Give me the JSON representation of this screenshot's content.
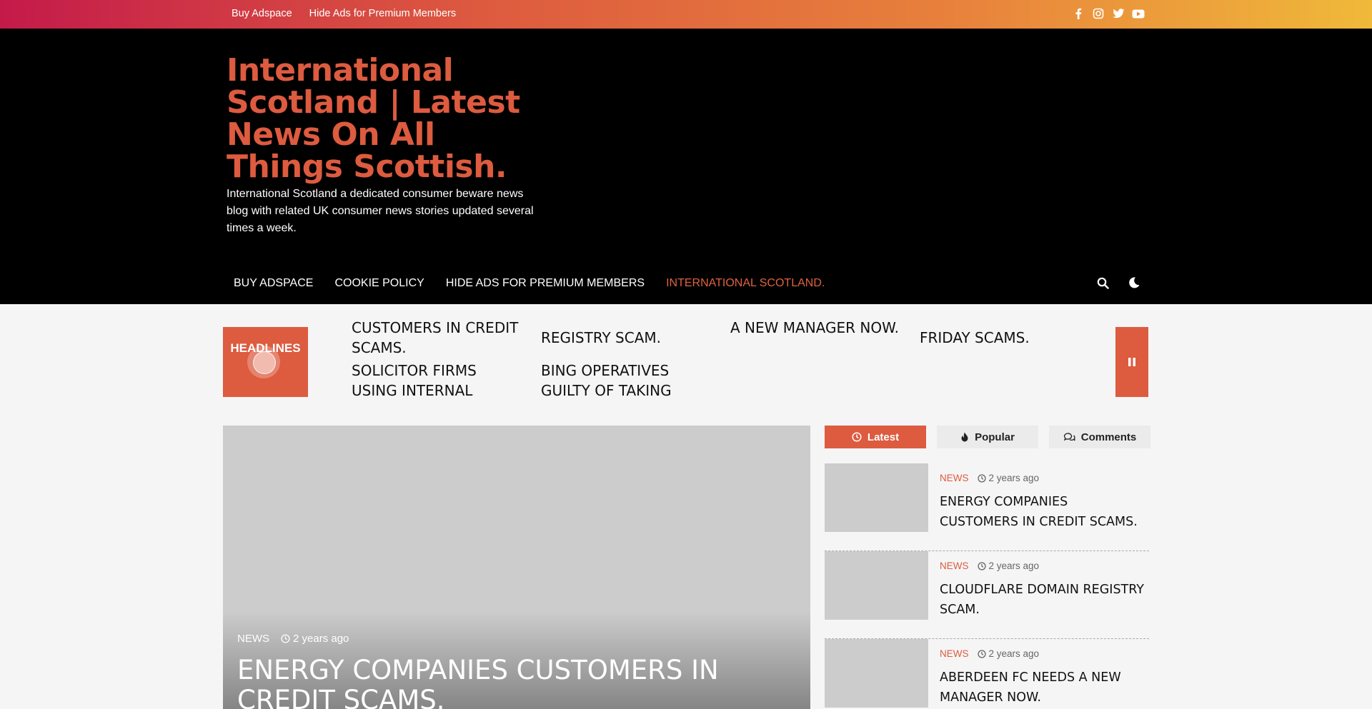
{
  "topbar": {
    "links": [
      "Buy Adspace",
      "Hide Ads for Premium Members"
    ],
    "social_icons": [
      "facebook-icon",
      "instagram-icon",
      "twitter-icon",
      "youtube-icon"
    ]
  },
  "header": {
    "title": "International Scotland | Latest News On All Things Scottish.",
    "description": "International Scotland a dedicated consumer beware news blog with related UK consumer news stories updated several times a week."
  },
  "nav": {
    "items": [
      "BUY ADSPACE",
      "COOKIE POLICY",
      "HIDE ADS FOR PREMIUM MEMBERS",
      "INTERNATIONAL SCOTLAND."
    ],
    "active_color": "#e0623f"
  },
  "ticker": {
    "label": "HEADLINES",
    "items": [
      "CUSTOMERS IN CREDIT SCAMS.",
      "REGISTRY SCAM.",
      "A NEW MANAGER NOW.",
      "FRIDAY SCAMS.",
      "SOLICITOR FIRMS USING INTERNAL",
      "BING OPERATIVES GUILTY OF TAKING"
    ]
  },
  "featured": {
    "category": "NEWS",
    "time": "2 years ago",
    "title": "ENERGY COMPANIES CUSTOMERS IN CREDIT SCAMS."
  },
  "sidebar": {
    "tabs": [
      {
        "label": "Latest",
        "icon": "clock-icon"
      },
      {
        "label": "Popular",
        "icon": "fire-icon"
      },
      {
        "label": "Comments",
        "icon": "comments-icon"
      }
    ],
    "posts": [
      {
        "category": "NEWS",
        "time": "2 years ago",
        "title": "ENERGY COMPANIES CUSTOMERS IN CREDIT SCAMS."
      },
      {
        "category": "NEWS",
        "time": "2 years ago",
        "title": "CLOUDFLARE DOMAIN REGISTRY SCAM."
      },
      {
        "category": "NEWS",
        "time": "2 years ago",
        "title": "ABERDEEN FC NEEDS A NEW MANAGER NOW."
      }
    ]
  },
  "colors": {
    "accent": "#dd5b3f",
    "header_bg": "#000000",
    "placeholder": "#cccccc"
  }
}
